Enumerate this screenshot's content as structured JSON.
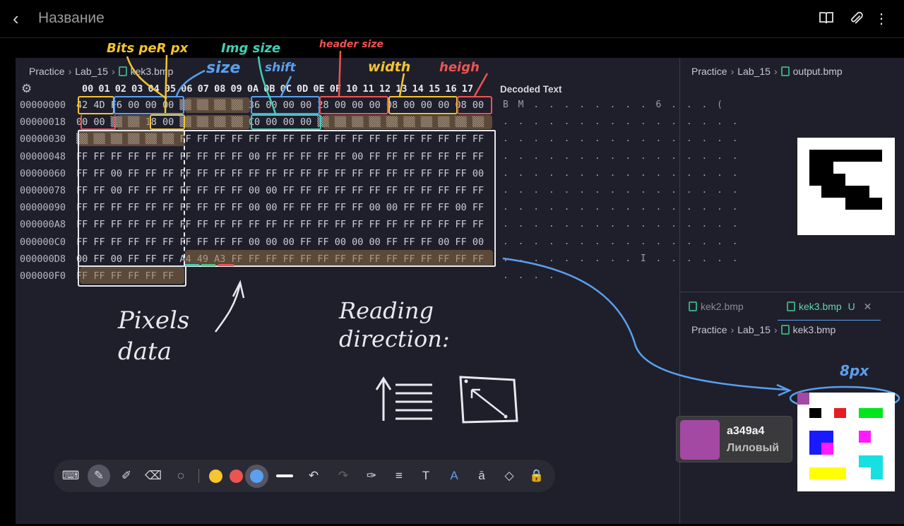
{
  "app": {
    "title": "Название",
    "icons": [
      "back-icon",
      "book-icon",
      "paperclip-icon",
      "more-vert-icon"
    ]
  },
  "editor": {
    "breadcrumb": {
      "root": "Practice",
      "folder": "Lab_15",
      "file": "kek3.bmp"
    },
    "hex_header": "00 01 02 03 04 05 06 07 08 09 0A 0B 0C 0D 0E 0F 10 11 12 13 14 15 16 17",
    "decoded_header": "Decoded Text",
    "rows": [
      {
        "offset": "00000000",
        "bytes": "42 4D F6 00 00 00 ▒▒ ▒▒ ▒▒ ▒▒ 36 00 00 00 28 00 00 00 08 00 00 00 08 00",
        "decoded": "B M . . . . . . . . 6 . . . ("
      },
      {
        "offset": "00000018",
        "bytes": "00 00 ▒▒ ▒▒ 18 00 ▒▒ ▒▒ ▒▒ ▒▒ C0 00 00 00 ▒▒ ▒▒ ▒▒ ▒▒ ▒▒ ▒▒ ▒▒ ▒▒ ▒▒ ▒▒",
        "decoded": ". . . . . . . . . . . . . . . ."
      },
      {
        "offset": "00000030",
        "bytes": "▒▒ ▒▒ ▒▒ ▒▒ ▒▒ ▒▒ FF FF FF FF FF FF FF FF FF FF FF FF FF FF FF FF FF FF",
        "decoded": ". . . . . . . . . . . . . . . ."
      },
      {
        "offset": "00000048",
        "bytes": "FF FF FF FF FF FF FF FF FF FF 00 FF FF FF FF FF 00 FF FF FF FF FF FF FF",
        "decoded": ". . . . . . . . . . . . . . . ."
      },
      {
        "offset": "00000060",
        "bytes": "FF FF 00 FF FF FF FF FF FF FF FF FF FF FF FF FF FF FF FF FF FF FF FF 00",
        "decoded": ". . . . . . . . . . . . . . . ."
      },
      {
        "offset": "00000078",
        "bytes": "FF FF 00 FF FF FF FF FF FF FF 00 00 FF FF FF FF FF FF FF FF FF FF FF FF",
        "decoded": ". . . . . . . . . . . . . . . ."
      },
      {
        "offset": "00000090",
        "bytes": "FF FF FF FF FF FF FF FF FF FF 00 00 FF FF FF FF FF 00 00 FF FF FF 00 FF",
        "decoded": ". . . . . . . . . . . . . . . ."
      },
      {
        "offset": "000000A8",
        "bytes": "FF FF FF FF FF FF FF FF FF FF FF FF FF FF FF FF FF FF FF FF FF FF FF FF",
        "decoded": ". . . . . . . . . . . . . . . ."
      },
      {
        "offset": "000000C0",
        "bytes": "FF FF FF FF FF FF FF FF FF FF 00 00 00 FF FF 00 00 00 FF FF FF 00 FF 00",
        "decoded": ". . . . . . . . . . . . . . . ."
      },
      {
        "offset": "000000D8",
        "bytes": "00 FF 00 FF FF FF A4 49 A3 FF FF FF FF FF FF FF FF FF FF FF FF FF FF FF",
        "decoded": ". . . . . . . . . I . . . . . ."
      },
      {
        "offset": "000000F0",
        "bytes": "FF FF FF FF FF FF",
        "decoded": ". . . ."
      }
    ]
  },
  "annotations": {
    "bits_per_px": "Bits peR px",
    "img_size": "Img size",
    "header_size": "header size",
    "size": "size",
    "shift": "shift",
    "width": "width",
    "height": "heigh",
    "pixels_data": "Pixels data",
    "reading_direction": "Reading direction:",
    "eight_px": "8px",
    "colors": {
      "yellow": "#f4c430",
      "blue": "#5aa0ef",
      "red": "#ef5350",
      "teal": "#3fd0b7",
      "orange": "#f7a72a"
    }
  },
  "right_top": {
    "breadcrumb": {
      "root": "Practice",
      "folder": "Lab_15",
      "file": "output.bmp"
    }
  },
  "right_bottom": {
    "tabs": [
      {
        "label": "kek2.bmp",
        "active": false
      },
      {
        "label": "kek3.bmp",
        "status": "U",
        "active": true
      }
    ],
    "breadcrumb": {
      "root": "Practice",
      "folder": "Lab_15",
      "file": "kek3.bmp"
    }
  },
  "swatch": {
    "hex": "a349a4",
    "name": "Лиловый",
    "color": "#a349a4"
  },
  "toolbar": {
    "tools": [
      "keyboard-icon",
      "pen-icon",
      "highlighter-icon",
      "eraser-icon",
      "lasso-icon",
      "undo-icon",
      "redo-icon",
      "pen-settings-icon",
      "align-icon",
      "text-icon",
      "text-style-icon",
      "text-box-icon",
      "shapes-icon",
      "lock-icon"
    ],
    "colors": [
      "#f7c530",
      "#ef5350",
      "#5aa0ef"
    ],
    "selected_color": "#5aa0ef"
  }
}
